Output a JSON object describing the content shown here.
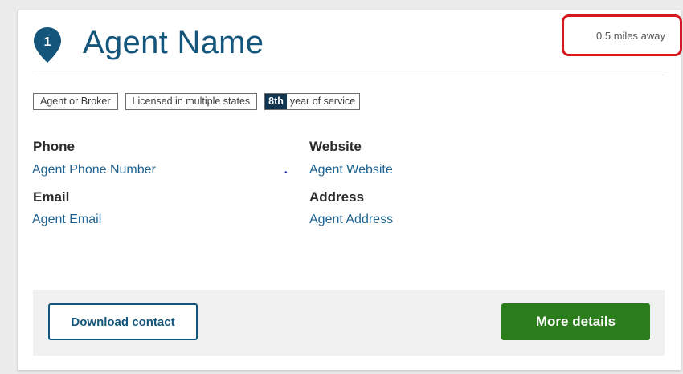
{
  "card": {
    "badge_number": "1",
    "agent_name": "Agent Name",
    "distance": "0.5 miles away",
    "tags": {
      "type": "Agent or Broker",
      "license": "Licensed in multiple states",
      "year_number": "8th",
      "year_text": "year of service"
    },
    "contact": {
      "phone_label": "Phone",
      "phone_value": "Agent Phone Number",
      "website_label": "Website",
      "website_value": "Agent Website",
      "email_label": "Email",
      "email_value": "Agent Email",
      "address_label": "Address",
      "address_value": "Agent Address",
      "separator": "•"
    },
    "footer": {
      "download_label": "Download contact",
      "more_label": "More details"
    }
  },
  "colors": {
    "brand_blue": "#14557b",
    "link_blue": "#1f6391",
    "highlight_red": "#d7191f",
    "action_green": "#2b7d1c",
    "badge_navy": "#0f3550"
  }
}
